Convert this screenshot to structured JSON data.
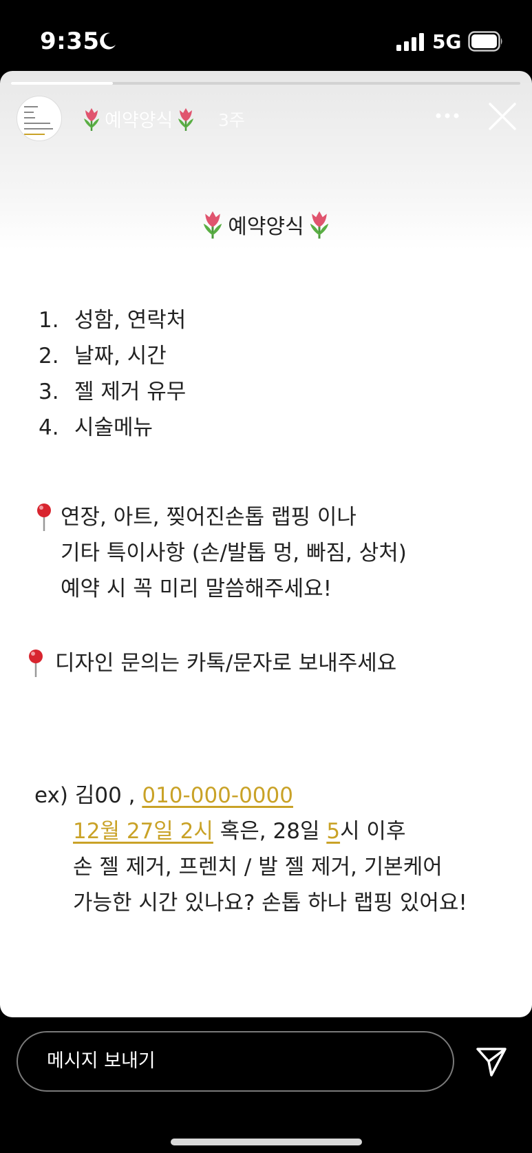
{
  "status_bar": {
    "time": "9:35",
    "network": "5G",
    "icons": [
      "moon-icon",
      "signal-icon",
      "battery-icon"
    ]
  },
  "story": {
    "progress": 0.2,
    "title": "예약양식",
    "time_ago": "3주",
    "icons": [
      "tulip-icon",
      "more-icon",
      "close-icon"
    ]
  },
  "content": {
    "heading": "예약양식",
    "list": [
      {
        "num": "1.",
        "text": "성함, 연락처"
      },
      {
        "num": "2.",
        "text": "날짜, 시간"
      },
      {
        "num": "3.",
        "text": "젤 제거 유무"
      },
      {
        "num": "4.",
        "text": "시술메뉴"
      }
    ],
    "note1": {
      "lines": [
        "연장, 아트, 찢어진손톱 랩핑 이나",
        "기타 특이사항 (손/발톱 멍, 빠짐, 상처)",
        "예약 시 꼭 미리 말씀해주세요!"
      ]
    },
    "note2": "디자인 문의는 카톡/문자로 보내주세요",
    "example": {
      "prefix": "ex) 김00 , ",
      "phone": "010-000-0000",
      "date_highlight": "12월 27일 2시",
      "line2_mid": " 혹은, 28일 ",
      "hour_highlight": "5",
      "line2_end": "시 이후",
      "line3": "손 젤 제거, 프렌치 / 발 젤 제거, 기본케어",
      "line4": "가능한 시간 있나요? 손톱 하나 랩핑 있어요!"
    },
    "highlight_color": "#c9a227"
  },
  "reply_bar": {
    "placeholder": "메시지 보내기",
    "icons": [
      "send-icon"
    ]
  }
}
